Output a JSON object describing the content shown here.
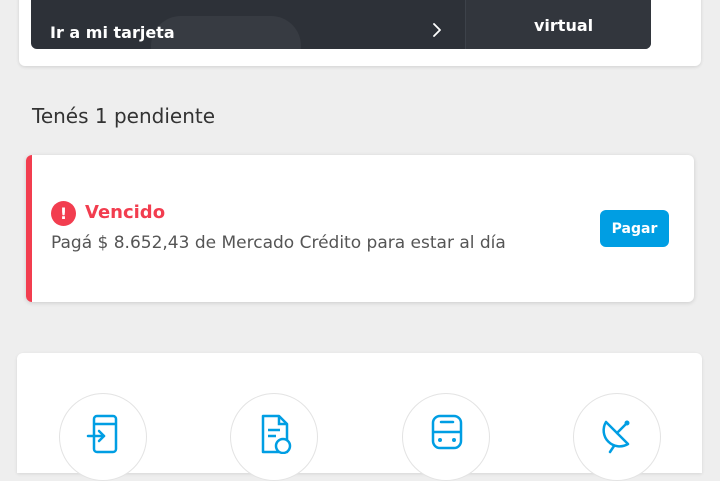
{
  "card": {
    "link_label": "Ir a mi tarjeta",
    "virtual_label": "virtual"
  },
  "pending": {
    "title": "Tenés 1 pendiente"
  },
  "alert": {
    "icon": "!",
    "status": "Vencido",
    "description": "Pagá $ 8.652,43 de Mercado Crédito para estar al día",
    "pay_button": "Pagar",
    "accent_color": "#f23d4f",
    "button_color": "#009ee3"
  },
  "shortcuts": {
    "icons": [
      "transfer-in-icon",
      "bill-payment-icon",
      "transport-icon",
      "satellite-tv-icon"
    ]
  }
}
